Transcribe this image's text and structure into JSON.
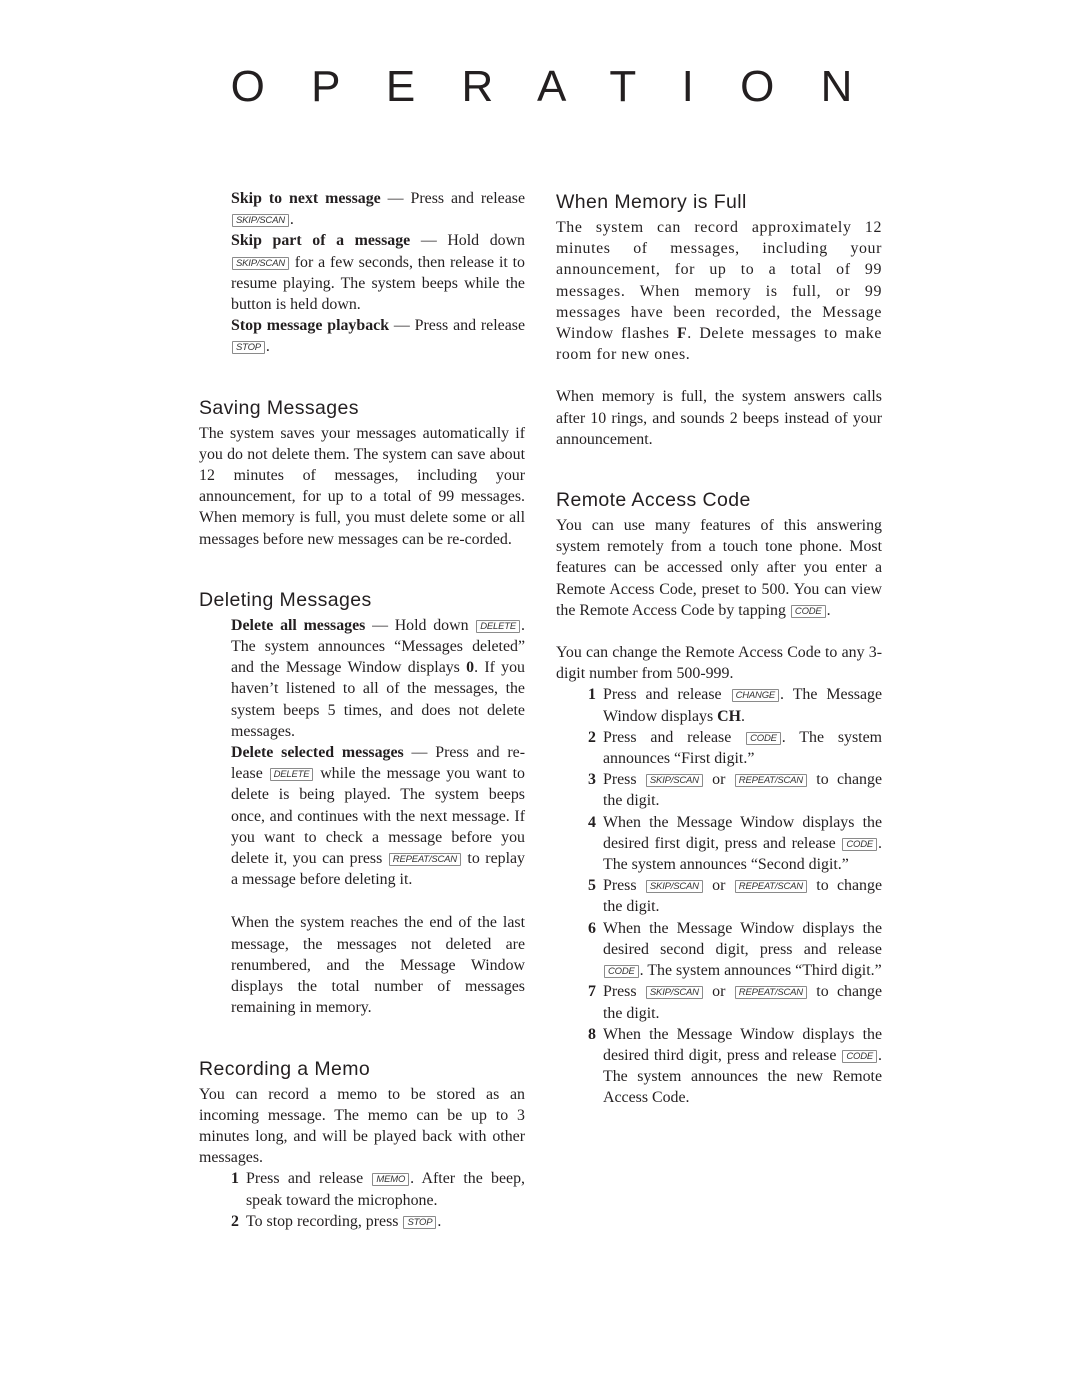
{
  "page_title": "O P E R A T I O N",
  "keys": {
    "skip_scan": "SKIP/SCAN",
    "stop": "STOP",
    "delete": "DELETE",
    "repeat_scan": "REPEAT/SCAN",
    "memo": "MEMO",
    "code": "CODE",
    "change": "CHANGE"
  },
  "left": {
    "playback": {
      "skip_next_bold": "Skip to next message",
      "skip_next_text": " — Press and release ",
      "skip_part_bold": "Skip part of a message",
      "skip_part_text1": " — Hold down ",
      "skip_part_text2": " for a few seconds, then release it to resume playing. The system beeps while the button is held down.",
      "stop_bold": "Stop message playback",
      "stop_text": " — Press and release "
    },
    "saving": {
      "heading": "Saving Messages",
      "body": "The system saves your messages automatically if you do not delete them. The system can save about 12 minutes of messages, including your announcement, for up to a total of 99 messages. When memory is full, you must delete some or all messages before new messages can be re-corded."
    },
    "deleting": {
      "heading": "Deleting Messages",
      "all_bold": "Delete all messages",
      "all_text1": " — Hold down ",
      "all_text2": ". The system announces “Messages deleted” and the Message Window displays ",
      "all_zero": "0",
      "all_text3": ". If you haven’t listened to all of the messages, the system beeps 5 times, and does not delete messages.",
      "selected_bold": "Delete selected messages",
      "selected_text1": " — Press and re-lease ",
      "selected_text2": " while the message you want to delete is being played. The system beeps once, and continues with the next message. If you want to check a message before you delete it, you can press ",
      "selected_text3": " to replay a message before deleting it.",
      "end_text": "When the system reaches the end of the last message, the messages not deleted are renumbered, and the Message Window displays the total number of messages remaining in memory."
    },
    "memo": {
      "heading": "Recording a Memo",
      "body": "You can record a memo to be stored as an incoming message. The memo can be up to 3 minutes long, and will be played back with other messages.",
      "step1_num": "1",
      "step1_a": "Press and release ",
      "step1_b": ". After the beep, speak toward the microphone.",
      "step2_num": "2",
      "step2_a": "To stop recording, press "
    }
  },
  "right": {
    "memory_full": {
      "heading": "When Memory is Full",
      "body1_a": "The system can record approximately 12 minutes of messages, including your announcement, for up to a total of 99 messages. When memory is full, or 99 messages have been recorded, the Message Window flashes ",
      "body1_f": "F",
      "body1_b": ". Delete messages to make room for new ones.",
      "body2": "When memory is full, the system answers calls after 10 rings, and sounds 2 beeps instead of your announcement."
    },
    "remote": {
      "heading": "Remote Access Code",
      "body1": "You can use many features of this answering system remotely from a touch tone phone. Most features can be accessed only after you enter a Remote Access Code, preset to 500. You can view the Remote Access Code by tapping ",
      "body2": "You can change the Remote Access Code to any 3-digit number from 500-999.",
      "s1_num": "1",
      "s1_a": "Press and release ",
      "s1_b": ". The Message Window displays ",
      "s1_ch": "CH",
      "s2_num": "2",
      "s2_a": "Press and release ",
      "s2_b": ". The system announces “First digit.”",
      "s3_num": "3",
      "s3_a": "Press ",
      "s3_or": " or ",
      "s3_b": " to change the digit.",
      "s4_num": "4",
      "s4_a": "When the Message Window displays the desired first digit, press and release ",
      "s4_b": ". The system announces “Second digit.”",
      "s5_num": "5",
      "s5_a": "Press ",
      "s5_or": " or ",
      "s5_b": " to change the digit.",
      "s6_num": "6",
      "s6_a": "When the Message Window displays the desired second digit, press and release ",
      "s6_b": ". The system announces “Third digit.”",
      "s7_num": "7",
      "s7_a": "Press ",
      "s7_or": " or ",
      "s7_b": " to change the digit.",
      "s8_num": "8",
      "s8_a": "When the Message Window displays the desired third digit, press and release ",
      "s8_b": ". The system announces the new Remote Access Code."
    }
  }
}
